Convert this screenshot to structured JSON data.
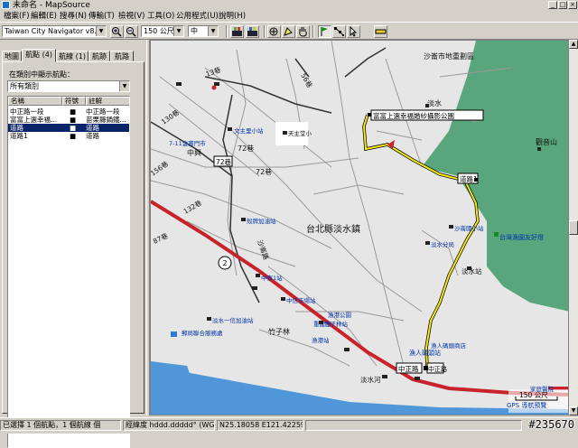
{
  "window": {
    "title": "未命名 - MapSource",
    "min": "_",
    "max": "□",
    "close": "×"
  },
  "menu": [
    "檔案(F)",
    "編輯(E)",
    "搜尋(N)",
    "傳輸(T)",
    "檢視(V)",
    "工具(O)",
    "公用程式(U)",
    "說明(H)"
  ],
  "toolbar": {
    "product": "Taiwan City Navigator v8.02",
    "zoom_scale": "150 公尺",
    "detail": "中",
    "zoom_in_icon": "magnifier-plus",
    "zoom_out_icon": "magnifier-minus"
  },
  "tabs": [
    "地圖",
    "航點 (4)",
    "航線 (1)",
    "航跡",
    "航路"
  ],
  "leftpanel": {
    "filter_label": "在類別中顯示航點：",
    "filter_value": "所有類別",
    "columns": [
      "名稱",
      "符號",
      "註解"
    ],
    "rows": [
      {
        "name": "中正路一段",
        "symbol": "■",
        "comment": "中正路一段",
        "selected": false
      },
      {
        "name": "富富上選幸福...",
        "symbol": "■",
        "comment": "苗栗縣鍋鐵...",
        "selected": false
      },
      {
        "name": "道路",
        "symbol": "■",
        "comment": "道路",
        "selected": true
      },
      {
        "name": "道路1",
        "symbol": "■",
        "comment": "道路",
        "selected": false
      }
    ]
  },
  "map": {
    "labels": {
      "district": "台北縣淡水鎮",
      "tamsui": "淡水",
      "shalun": "沙崙市地重劃區",
      "park": "富富上選幸福婚紗攝影公園",
      "road_label": "道路1",
      "guanyinshan": "觀音山",
      "lighthouse": "台灣漁園友好燈",
      "zhongzheng": "中正路",
      "zhongzheng2": "中正路",
      "river": "淡水河",
      "bamboo": "竹子林",
      "liwoxi": "沙崙路",
      "seventytwo": "72巷",
      "seventytwo_b": "72巷",
      "one30": "130巷",
      "fifteen": "156巷",
      "eighty7": "87巷",
      "one32": "132巷",
      "thirteen": "13巷",
      "fifty6": "56巷",
      "zhongxing": "中興",
      "tianyuan": "淡水站",
      "harbour": "漁人碼頭站",
      "scale": "150 公尺",
      "gps_note": "GPS 導航預覽",
      "bldg_note": "家庭醫院",
      "route_no": "2",
      "route_circle": "2",
      "sign_72": "72巷",
      "pois": [
        "文主里小站",
        "天主堂小",
        "7-11金寶門市",
        "老街時區",
        "殼牌加油站",
        "淡水鎮公所",
        "文化國小",
        "中寮1站",
        "中寮2站",
        "中信市場站",
        "沙崙國小站",
        "淡水分局",
        "竹子林站",
        "淡水一信加油站",
        "郵局聯合服務處",
        "擇富民宿",
        "漁港站",
        "沙崙海水浴場",
        "漁人碼頭商店",
        "漁港公園",
        "淡水漁人碼頭",
        "重建街",
        "淡水戲院",
        "漁會大樓"
      ]
    }
  },
  "statusbar": {
    "selection": "已選擇 1 個航點，1 個航線 個",
    "coord_format": "經緯度 hddd.ddddd° (WGS 84)",
    "coords": "N25.18058 E121.42259"
  },
  "watermark": "#235670",
  "colors": {
    "highway": "#c8222a",
    "route": "#f5ea14",
    "sea": "#5aa67c",
    "river": "#4f97d8",
    "selection": "#0a246a"
  }
}
